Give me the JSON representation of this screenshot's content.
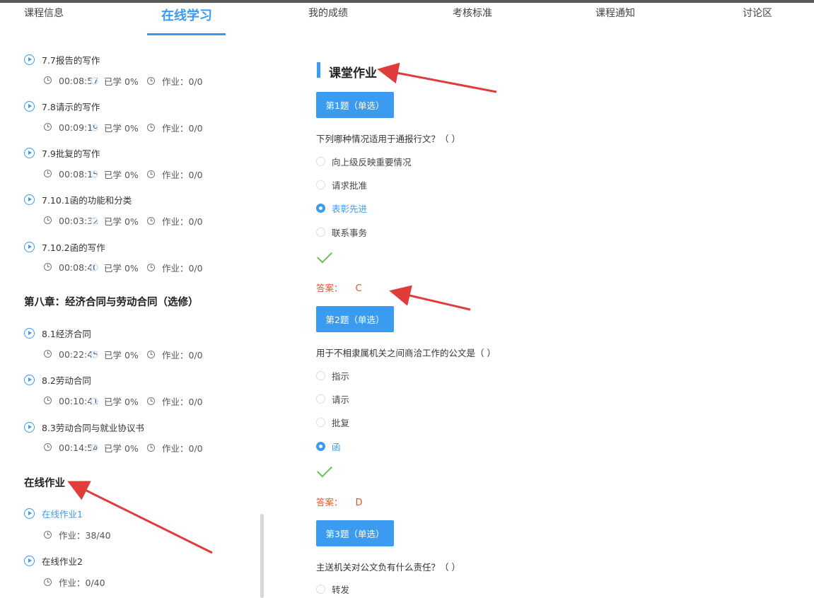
{
  "nav": {
    "tabs": [
      {
        "label": "课程信息"
      },
      {
        "label": "在线学习",
        "active": true
      },
      {
        "label": "我的成绩"
      },
      {
        "label": "考核标准"
      },
      {
        "label": "课程通知"
      },
      {
        "label": "讨论区"
      }
    ]
  },
  "sidebar": {
    "lessons": [
      {
        "title": "7.7报告的写作",
        "duration": "00:08:57",
        "learned": "已学 0%",
        "homework": "作业：0/0"
      },
      {
        "title": "7.8请示的写作",
        "duration": "00:09:19",
        "learned": "已学 0%",
        "homework": "作业：0/0"
      },
      {
        "title": "7.9批复的写作",
        "duration": "00:08:15",
        "learned": "已学 0%",
        "homework": "作业：0/0"
      },
      {
        "title": "7.10.1函的功能和分类",
        "duration": "00:03:32",
        "learned": "已学 0%",
        "homework": "作业：0/0"
      },
      {
        "title": "7.10.2函的写作",
        "duration": "00:08:40",
        "learned": "已学 0%",
        "homework": "作业：0/0"
      }
    ],
    "chapter8": {
      "title": "第八章：经济合同与劳动合同（选修）",
      "lessons": [
        {
          "title": "8.1经济合同",
          "duration": "00:22:45",
          "learned": "已学 0%",
          "homework": "作业：0/0"
        },
        {
          "title": "8.2劳动合同",
          "duration": "00:10:41",
          "learned": "已学 0%",
          "homework": "作业：0/0"
        },
        {
          "title": "8.3劳动合同与就业协议书",
          "duration": "00:14:54",
          "learned": "已学 0%",
          "homework": "作业：0/0"
        }
      ]
    },
    "online_homework": {
      "title": "在线作业",
      "items": [
        {
          "title": "在线作业1",
          "homework": "作业：38/40"
        },
        {
          "title": "在线作业2",
          "homework": "作业：0/40"
        }
      ]
    }
  },
  "main": {
    "section_title": "课堂作业",
    "answer_label": "答案：",
    "questions": [
      {
        "label": "第1题（单选）",
        "text": "下列哪种情况适用于通报行文？（ ）",
        "options": [
          "向上级反映重要情况",
          "请求批准",
          "表彰先进",
          "联系事务"
        ],
        "selected": 2,
        "answer": "C"
      },
      {
        "label": "第2题（单选）",
        "text": "用于不相隶属机关之间商洽工作的公文是（ ）",
        "options": [
          "指示",
          "请示",
          "批复",
          "函"
        ],
        "selected": 3,
        "answer": "D"
      },
      {
        "label": "第3题（单选）",
        "text": "主送机关对公文负有什么责任？（ ）",
        "options": [
          "转发"
        ]
      }
    ]
  },
  "colors": {
    "accent": "#3a9bf0",
    "answer": "#e0562b",
    "check": "#6dc25e",
    "arrow": "#e03c3c"
  }
}
